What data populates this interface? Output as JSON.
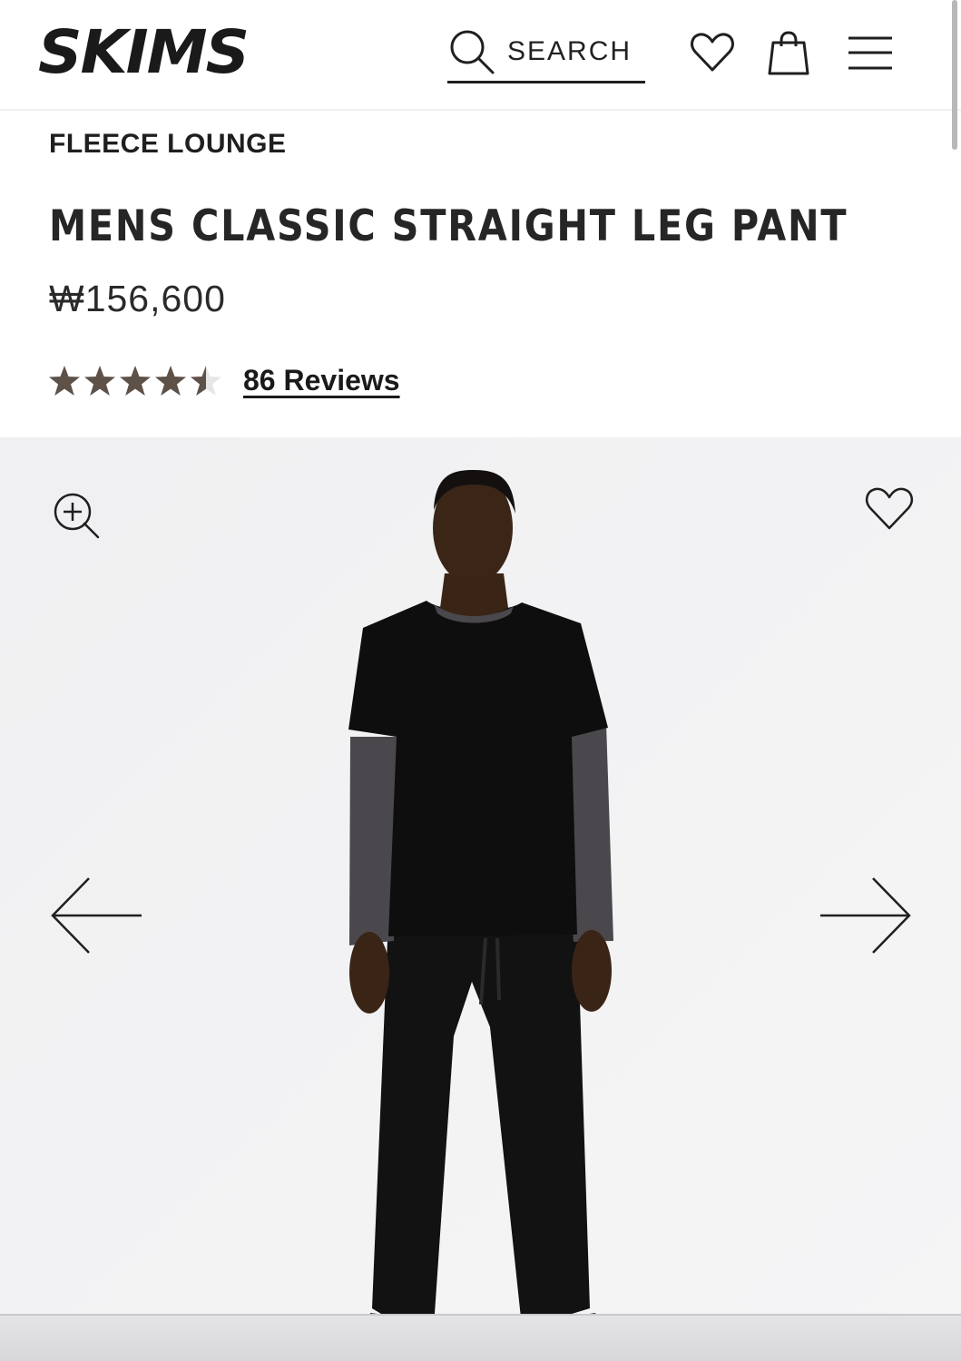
{
  "header": {
    "logo_text": "SKIMS",
    "search_label": "SEARCH",
    "icons": [
      "search-icon",
      "heart-icon",
      "shopping-bag-icon",
      "hamburger-menu-icon"
    ]
  },
  "product": {
    "collection": "FLEECE LOUNGE",
    "title": "MENS CLASSIC STRAIGHT LEG PANT",
    "price": "₩156,600",
    "rating": 4.5,
    "rating_max": 5,
    "reviews_label": "86 Reviews"
  },
  "gallery": {
    "icons": [
      "zoom-in-icon",
      "heart-icon",
      "arrow-left-icon",
      "arrow-right-icon"
    ]
  },
  "colors": {
    "text": "#1f1f1f",
    "star": "#5e5148",
    "gallery_bg": "#f2f2f3"
  }
}
